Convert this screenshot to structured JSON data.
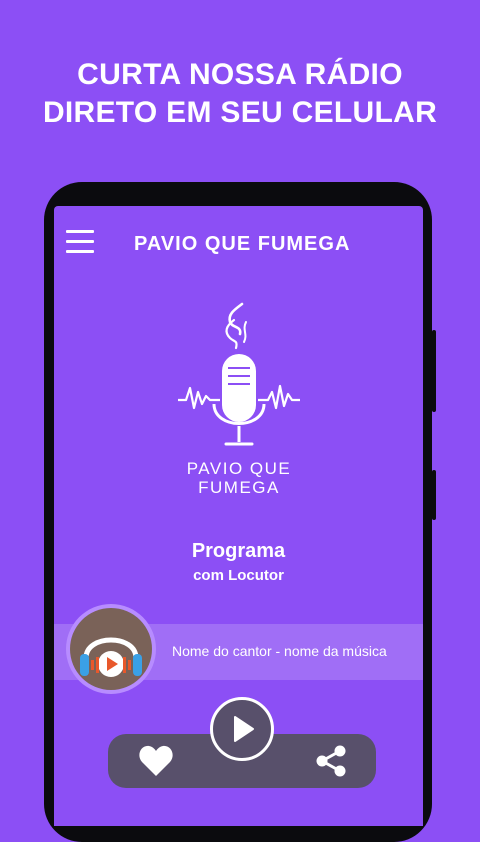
{
  "promo": {
    "line1": "CURTA NOSSA RÁDIO",
    "line2": "DIRETO EM SEU CELULAR"
  },
  "app": {
    "title": "PAVIO QUE FUMEGA",
    "menu_icon": "hamburger-menu-icon"
  },
  "logo": {
    "line1": "PAVIO QUE",
    "line2": "FUMEGA"
  },
  "program": {
    "title": "Programa",
    "host": "com Locutor"
  },
  "now_playing": {
    "text": "Nome do cantor - nome da música",
    "album_icon": "headphones-play-icon"
  },
  "controls": {
    "favorite_icon": "heart-icon",
    "play_icon": "play-icon",
    "share_icon": "share-icon"
  },
  "colors": {
    "background": "#8c4ff5",
    "phone_frame": "#0b0b0e",
    "control_bar": "#58506b",
    "accent_orange": "#e8582b",
    "headphone_blue": "#3aa0e6"
  }
}
